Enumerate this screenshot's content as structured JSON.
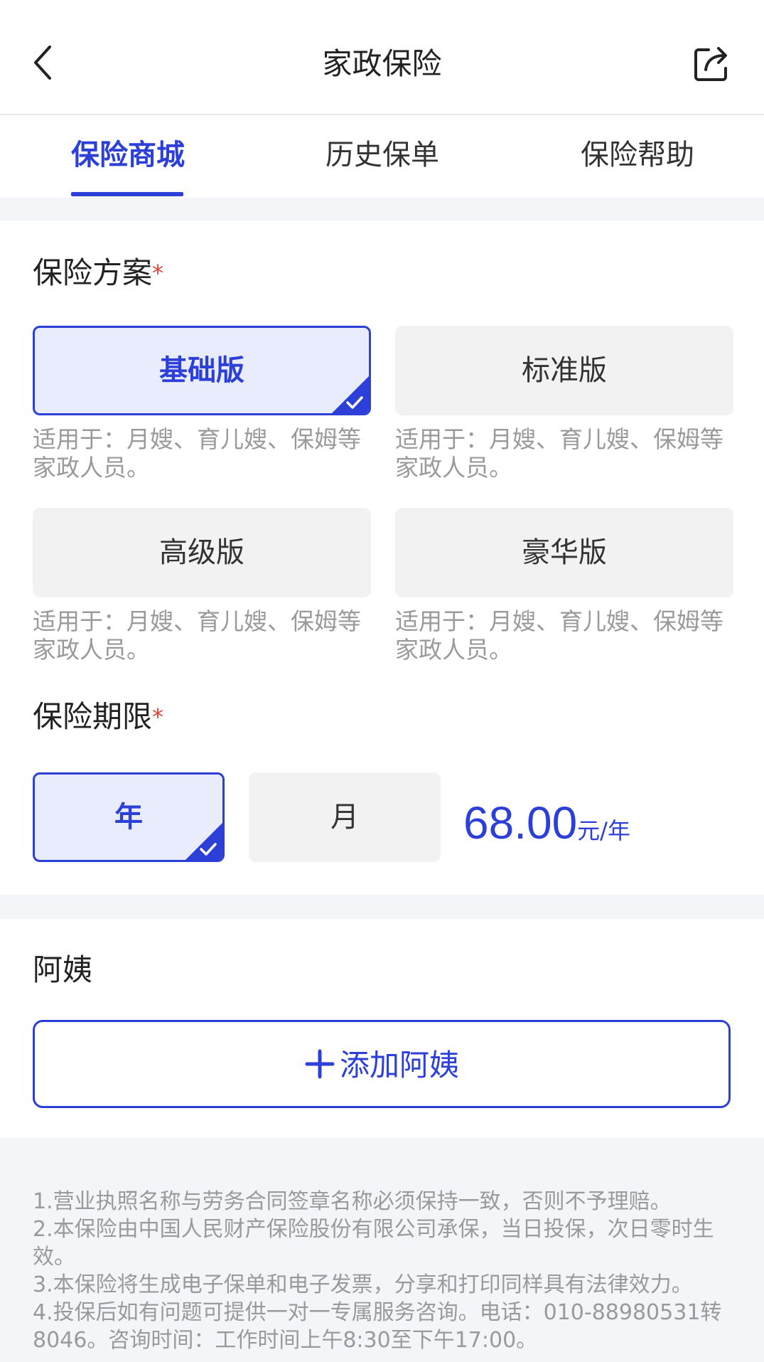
{
  "navbar": {
    "title": "家政保险"
  },
  "tabs": [
    {
      "label": "保险商城",
      "active": true
    },
    {
      "label": "历史保单",
      "active": false
    },
    {
      "label": "保险帮助",
      "active": false
    }
  ],
  "plan": {
    "title": "保险方案",
    "required_mark": "*",
    "options": [
      {
        "label": "基础版",
        "selected": true,
        "desc": "适用于：月嫂、育儿嫂、保姆等家政人员。"
      },
      {
        "label": "标准版",
        "selected": false,
        "desc": "适用于：月嫂、育儿嫂、保姆等家政人员。"
      },
      {
        "label": "高级版",
        "selected": false,
        "desc": "适用于：月嫂、育儿嫂、保姆等家政人员。"
      },
      {
        "label": "豪华版",
        "selected": false,
        "desc": "适用于：月嫂、育儿嫂、保姆等家政人员。"
      }
    ]
  },
  "term": {
    "title": "保险期限",
    "required_mark": "*",
    "options": [
      {
        "label": "年",
        "selected": true
      },
      {
        "label": "月",
        "selected": false
      }
    ],
    "price": "68.00",
    "price_unit": "元/年"
  },
  "aunt": {
    "title": "阿姨",
    "add_label": "添加阿姨"
  },
  "notes": [
    "1.营业执照名称与劳务合同签章名称必须保持一致，否则不予理赔。",
    "2.本保险由中国人民财产保险股份有限公司承保，当日投保，次日零时生效。",
    "3.本保险将生成电子保单和电子发票，分享和打印同样具有法律效力。",
    "4.投保后如有问题可提供一对一专属服务咨询。电话：010-88980531转8046。咨询时间：工作时间上午8:30至下午17:00。"
  ],
  "colors": {
    "accent": "#2c3fd6",
    "required": "#e0433a",
    "muted_text": "#9a9a9a"
  },
  "icons": {
    "back": "chevron-left-icon",
    "share": "share-icon",
    "check": "check-icon",
    "add": "plus-icon"
  }
}
